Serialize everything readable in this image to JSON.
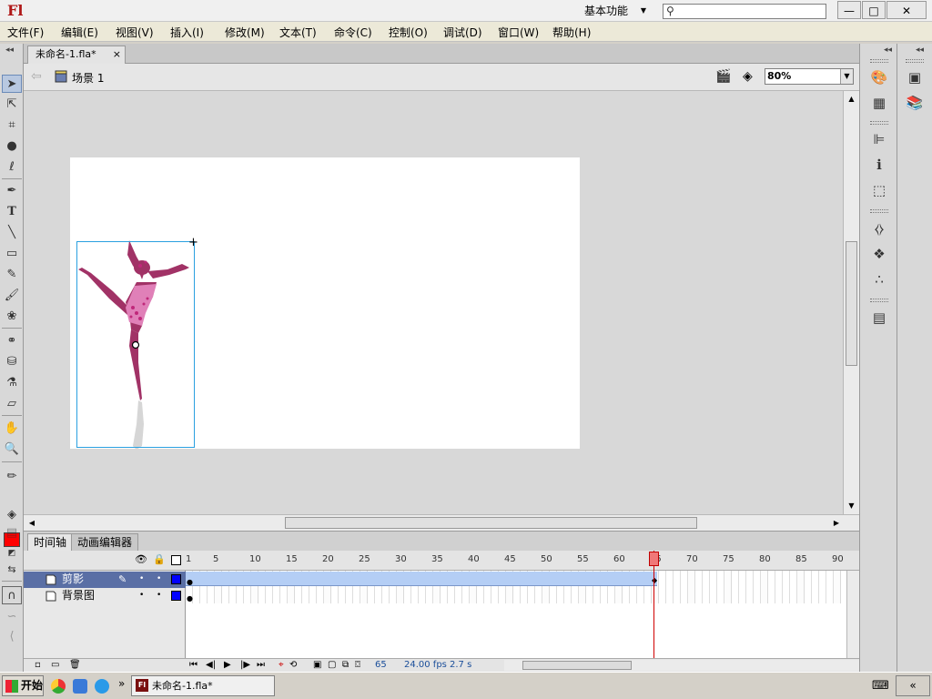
{
  "app": {
    "logo": "Fl",
    "workspace": "基本功能",
    "window_controls": [
      "—",
      "□",
      "✕"
    ]
  },
  "menu": [
    "文件(F)",
    "编辑(E)",
    "视图(V)",
    "插入(I)",
    "修改(M)",
    "文本(T)",
    "命令(C)",
    "控制(O)",
    "调试(D)",
    "窗口(W)",
    "帮助(H)"
  ],
  "document": {
    "tab_title": "未命名-1.fla*",
    "tab_close": "×",
    "scene": "场景 1",
    "zoom": "80%"
  },
  "timeline": {
    "tabs": [
      "时间轴",
      "动画编辑器"
    ],
    "frame_numbers": [
      "1",
      "5",
      "10",
      "15",
      "20",
      "25",
      "30",
      "35",
      "40",
      "45",
      "50",
      "55",
      "60",
      "65",
      "70",
      "75",
      "80",
      "85",
      "90"
    ],
    "layers": [
      {
        "name": "剪影",
        "selected": true
      },
      {
        "name": "背景图",
        "selected": false
      }
    ],
    "current_frame": "65",
    "fps": "24.00 fps",
    "time": "2.7 s"
  },
  "taskbar": {
    "start": "开始",
    "task": "未命名-1.fla*",
    "chevron": "»"
  },
  "colors": {
    "stroke": "#ff0000",
    "layer_color": "#0000ff",
    "tween": "#b4cef5",
    "playhead": "#d00000"
  }
}
